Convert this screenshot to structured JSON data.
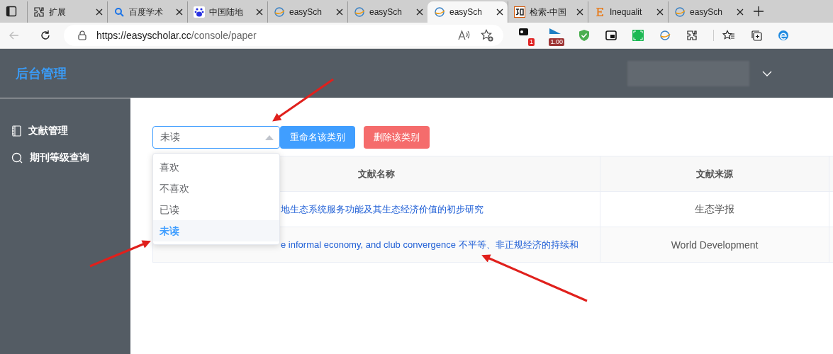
{
  "browser": {
    "tabs": [
      {
        "kind": "puzzle",
        "title": "扩展",
        "selected": false
      },
      {
        "kind": "search",
        "title": "百度学术",
        "selected": false
      },
      {
        "kind": "paw",
        "title": "中国陆地",
        "selected": false
      },
      {
        "kind": "globe",
        "title": "easySch",
        "selected": false
      },
      {
        "kind": "globe",
        "title": "easySch",
        "selected": false
      },
      {
        "kind": "globe",
        "title": "easySch",
        "selected": true
      },
      {
        "kind": "zhi",
        "title": "检索-中国",
        "selected": false
      },
      {
        "kind": "letter",
        "title": "Inequalit",
        "selected": false
      },
      {
        "kind": "globe",
        "title": "easySch",
        "selected": false
      }
    ],
    "url": {
      "host": "https://easyscholar.cc",
      "path": "/console/paper"
    },
    "extensions": [
      {
        "kind": "notes",
        "badge": "1"
      },
      {
        "kind": "flag",
        "badge": "1.00"
      },
      {
        "kind": "shield"
      },
      {
        "kind": "pip"
      },
      {
        "kind": "ocr"
      },
      {
        "kind": "globe"
      },
      {
        "kind": "puzzle"
      },
      {
        "kind": "favorites"
      },
      {
        "kind": "collections"
      },
      {
        "kind": "edge"
      }
    ]
  },
  "app": {
    "title": "后台管理"
  },
  "sidebar": {
    "items": [
      {
        "kind": "notebook",
        "label": "文献管理"
      },
      {
        "kind": "search",
        "label": "期刊等级查询"
      }
    ]
  },
  "category_select": {
    "value": "未读",
    "expanded": true,
    "options": [
      {
        "label": "喜欢",
        "selected": false
      },
      {
        "label": "不喜欢",
        "selected": false
      },
      {
        "label": "已读",
        "selected": false
      },
      {
        "label": "未读",
        "selected": true
      }
    ]
  },
  "buttons": [
    {
      "kind": "primary",
      "label": "重命名该类别"
    },
    {
      "kind": "danger",
      "label": "删除该类别"
    }
  ],
  "table": {
    "columns": [
      "文献名称",
      "文献来源"
    ],
    "rows": [
      {
        "title": "地生态系统服务功能及其生态经济价值的初步研究",
        "source": "生态学报"
      },
      {
        "title": "e informal economy, and club convergence 不平等、非正规经济的持续和",
        "source": "World Development"
      }
    ]
  }
}
